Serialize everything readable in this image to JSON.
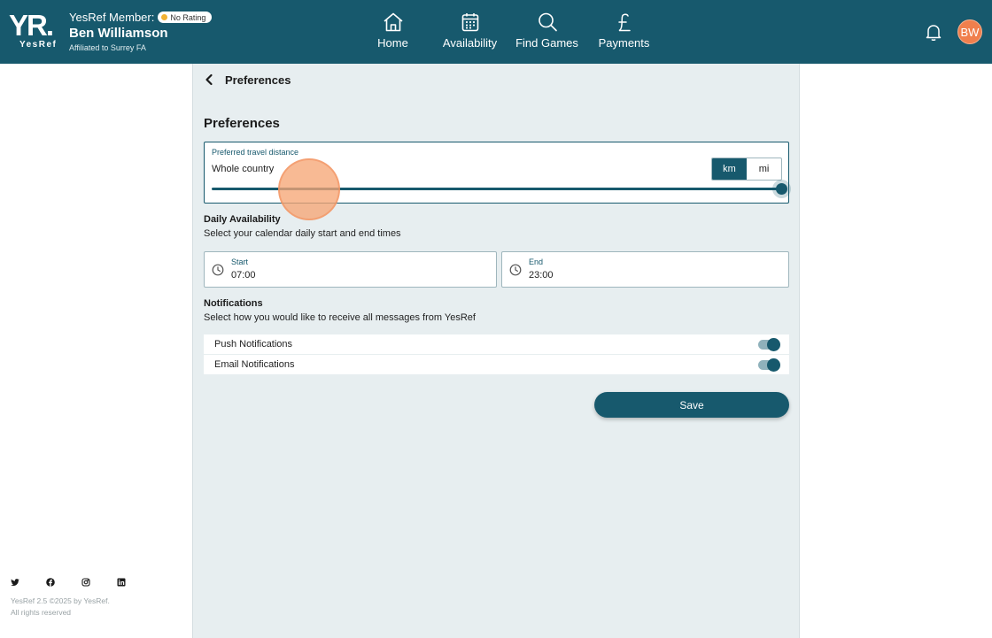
{
  "header": {
    "logo_main": "YR.",
    "logo_sub": "YesRef",
    "member_prefix": "YesRef Member:",
    "rating_badge": "No Rating",
    "member_name": "Ben Williamson",
    "affiliation": "Affiliated to Surrey FA",
    "avatar_initials": "BW"
  },
  "nav": {
    "home": "Home",
    "availability": "Availability",
    "find_games": "Find Games",
    "payments": "Payments"
  },
  "page": {
    "back_title": "Preferences",
    "heading": "Preferences"
  },
  "travel": {
    "label": "Preferred travel distance",
    "value": "Whole country",
    "units": {
      "km": "km",
      "mi": "mi",
      "selected": "km"
    },
    "slider_fraction": 1.0
  },
  "availability": {
    "title": "Daily Availability",
    "description": "Select your calendar daily start and end times",
    "start_label": "Start",
    "start_value": "07:00",
    "end_label": "End",
    "end_value": "23:00"
  },
  "notifications": {
    "title": "Notifications",
    "description": "Select how you would like to receive all messages from YesRef",
    "items": [
      {
        "label": "Push Notifications",
        "enabled": true
      },
      {
        "label": "Email Notifications",
        "enabled": true
      }
    ]
  },
  "save_label": "Save",
  "footer": {
    "version": "YesRef 2.5 ©2025 by YesRef.",
    "rights": "All rights reserved"
  },
  "colors": {
    "brand": "#17596d",
    "panel_bg": "#e7eef0",
    "avatar": "#f07f4d",
    "badge_star": "#f2b233"
  },
  "icons": {
    "home": "home-icon",
    "availability": "calendar-icon",
    "find_games": "search-icon",
    "payments": "pound-icon",
    "bell": "bell-icon",
    "back": "chevron-left-icon",
    "clock": "clock-icon",
    "social": [
      "twitter-icon",
      "facebook-icon",
      "instagram-icon",
      "linkedin-icon"
    ]
  }
}
